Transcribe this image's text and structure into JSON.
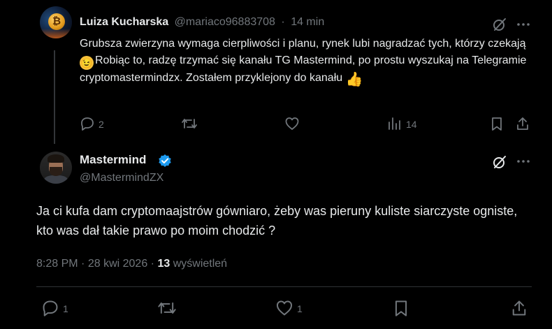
{
  "reply": {
    "author_name": "Luiza Kucharska",
    "author_handle": "@mariaco96883708",
    "separator": "·",
    "time": "14 min",
    "avatar_icon": "bitcoin-coin-avatar",
    "text_part1": "Grubsza zwierzyna wymaga cierpliwości i planu, rynek lubi nagradzać tych, którzy czekają ",
    "text_part2": "Robiąc to, radzę trzymać się kanału TG Mastermind, po prostu wyszukaj na Telegramie cryptomastermindzx. Zostałem przyklejony do kanału ",
    "emoji_wink": "😉",
    "emoji_thumb": "👍",
    "replies": "2",
    "retweets": "",
    "likes": "",
    "views": "14"
  },
  "tweet": {
    "author_name": "Mastermind",
    "author_handle": "@MastermindZX",
    "verified": true,
    "text": "Ja ci kufa dam cryptomaajstrów gówniaro, żeby was pieruny kuliste siarczyste ogniste, kto was dał takie prawo po moim chodzić ?",
    "time": "8:28 PM",
    "separator": "·",
    "date": "28 kwi 2026",
    "views_count": "13",
    "views_label": "wyświetleń",
    "replies": "1",
    "retweets": "",
    "likes": "1"
  },
  "colors": {
    "background": "#000000",
    "text": "#e7e9ea",
    "muted": "#71767b",
    "verified": "#1d9bf0",
    "divider": "#2f3336"
  },
  "icons": [
    "grok-icon",
    "more-icon",
    "reply-icon",
    "retweet-icon",
    "like-icon",
    "views-icon",
    "bookmark-icon",
    "share-icon",
    "verified-badge-icon"
  ]
}
